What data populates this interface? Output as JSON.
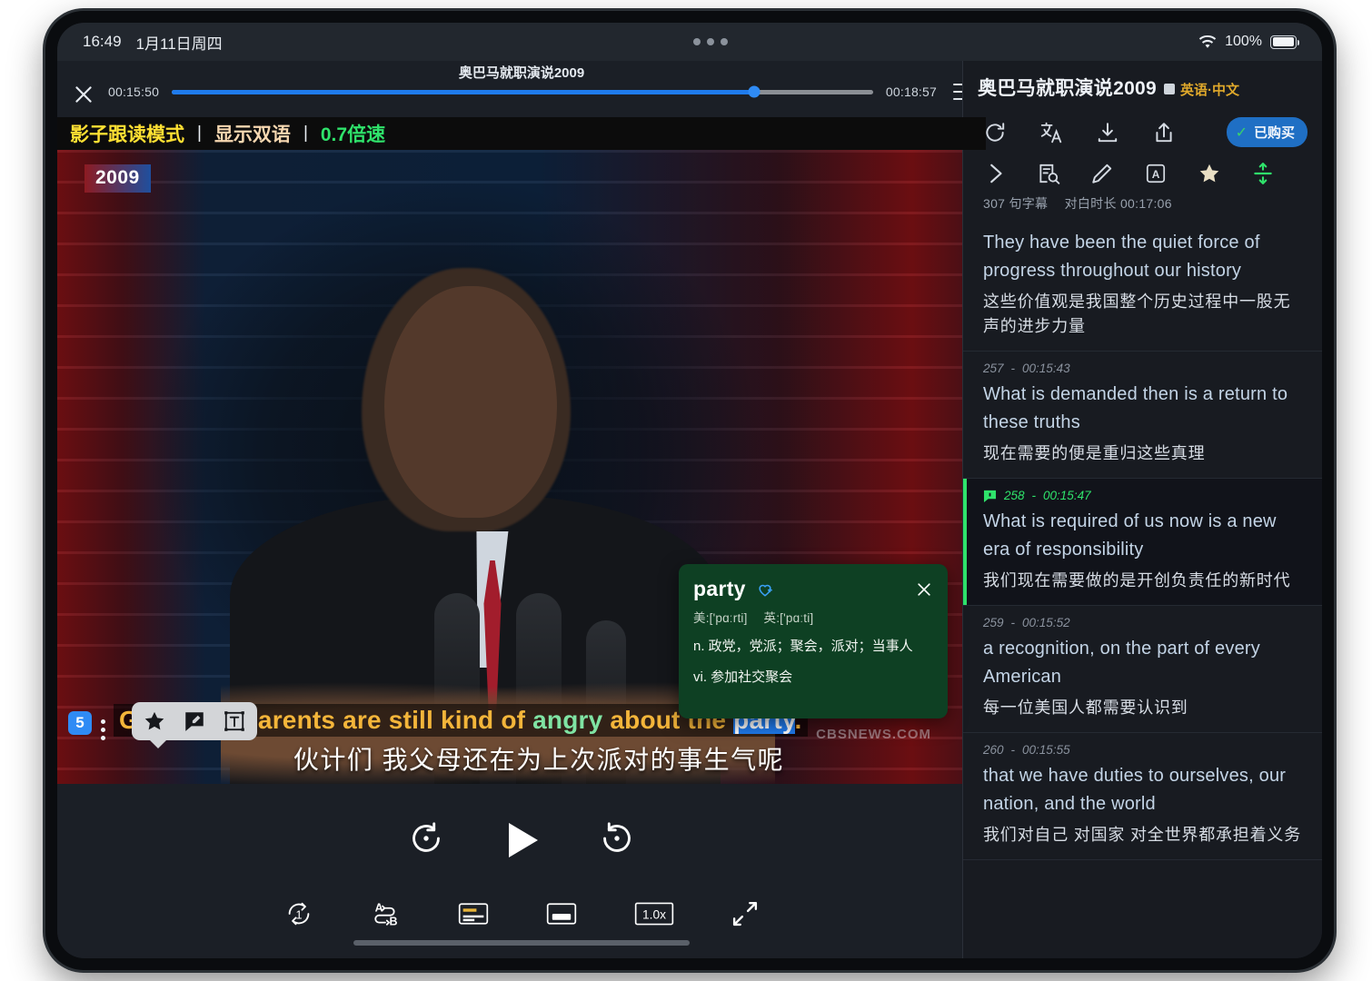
{
  "status_bar": {
    "time": "16:49",
    "date": "1月11日周四",
    "wifi_icon": "wifi-icon",
    "battery_percent": "100%"
  },
  "player": {
    "close_icon": "close-icon",
    "menu_icon": "hamburger-menu-icon",
    "title": "奥巴马就职演说2009",
    "current_time": "00:15:50",
    "total_time": "00:18:57",
    "progress_percent": 83,
    "mode_bar": {
      "shadow_mode": "影子跟读模式",
      "separator": "|",
      "bilingual": "显示双语",
      "speed": "0.7倍速"
    },
    "video": {
      "year_badge": "2009",
      "watermark": "CBSNEWS.COM"
    },
    "subtitle": {
      "index_badge": "5",
      "kebab_icon": "kebab-menu-icon",
      "english_tokens": [
        {
          "text": "Guys, my parents are still kind of ",
          "style": "yellow"
        },
        {
          "text": "angry",
          "style": "green"
        },
        {
          "text": " about the ",
          "style": "yellow"
        },
        {
          "text": "party",
          "style": "selected"
        },
        {
          "text": ".",
          "style": "yellow"
        }
      ],
      "chinese": "伙计们 我父母还在为上次派对的事生气呢"
    },
    "subtitle_toolbar": {
      "star_icon": "star-icon",
      "note_icon": "comment-edit-icon",
      "text_icon": "text-box-icon"
    },
    "transport": {
      "rewind_icon": "rewind-5s-icon",
      "play_icon": "play-icon",
      "forward_icon": "forward-5s-icon"
    },
    "toolbar": {
      "repeat_one_icon": "repeat-one-icon",
      "ab_loop_icon": "ab-loop-icon",
      "dual_subtitle_icon": "dual-subtitle-icon",
      "single_subtitle_icon": "single-subtitle-icon",
      "speed_label": "1.0x",
      "fullscreen_icon": "fullscreen-icon"
    }
  },
  "dictionary": {
    "word": "party",
    "favorite_icon": "heart-plus-icon",
    "close_icon": "close-icon",
    "phonetic_us": "美:['pɑːrti]",
    "phonetic_uk": "英:['pɑːti]",
    "definitions": [
      "n. 政党，党派；聚会，派对；当事人",
      "vi. 参加社交聚会"
    ]
  },
  "side_panel": {
    "title": "奥巴马就职演说2009",
    "lang_chip": "英语·中文",
    "actions": {
      "refresh_icon": "refresh-icon",
      "translate_icon": "translate-icon",
      "download_icon": "download-icon",
      "share_icon": "share-icon",
      "purchased_label": "已购买"
    },
    "tools": {
      "expand_icon": "chevron-right-icon",
      "doc_search_icon": "document-search-icon",
      "pencil_icon": "pencil-icon",
      "translate_box_icon": "translate-box-icon",
      "star_icon": "star-icon",
      "split_icon": "split-divider-icon"
    },
    "meta": {
      "subtitle_count": "307 句字幕",
      "duration_label": "对白时长 00:17:06"
    },
    "items": [
      {
        "index": "",
        "time": "",
        "english": "They have been the quiet force of progress throughout our history",
        "chinese": "这些价值观是我国整个历史过程中一股无声的进步力量",
        "active": false,
        "has_note": false
      },
      {
        "index": "257",
        "time": "00:15:43",
        "english": "What is demanded then is a return to these truths",
        "chinese": "现在需要的便是重归这些真理",
        "active": false,
        "has_note": false
      },
      {
        "index": "258",
        "time": "00:15:47",
        "english": "What is required of us now is a new era of responsibility",
        "chinese": "我们现在需要做的是开创负责任的新时代",
        "active": true,
        "has_note": true
      },
      {
        "index": "259",
        "time": "00:15:52",
        "english": "a recognition, on the part of every American",
        "chinese": "每一位美国人都需要认识到",
        "active": false,
        "has_note": false
      },
      {
        "index": "260",
        "time": "00:15:55",
        "english": "that we have duties to ourselves, our nation, and the world",
        "chinese": "我们对自己 对国家 对全世界都承担着义务",
        "active": false,
        "has_note": false
      }
    ]
  },
  "colors": {
    "accent_blue": "#1f7bed",
    "accent_green": "#2fe36b",
    "mode_yellow": "#ffe033",
    "lang_gold": "#e0a92b",
    "dict_green": "#0e4023"
  }
}
